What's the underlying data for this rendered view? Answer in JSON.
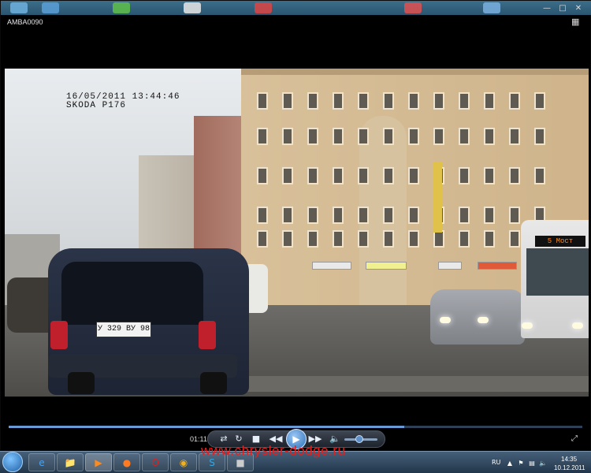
{
  "window": {
    "title": "AMBA0090",
    "minimize_icon": "minimize-icon",
    "maximize_icon": "maximize-icon",
    "close_icon": "close-icon"
  },
  "video": {
    "osd_line1": "16/05/2011  13:44:46",
    "osd_line2": "SKODA P176",
    "plate": "У 329 ВУ 98",
    "bus_destination": "5  Мост"
  },
  "player": {
    "elapsed_time": "01:11",
    "progress_fraction": 0.69,
    "volume_fraction": 0.45,
    "controls": [
      "shuffle-icon",
      "repeat-icon",
      "stop-icon",
      "previous-icon",
      "play-icon",
      "next-icon",
      "volume-icon"
    ],
    "accent_color": "#2a6fb8"
  },
  "taskbar": {
    "watermark": "www.chrysler-dodge.ru",
    "language": "RU",
    "clock_time": "14:35",
    "clock_date": "10.12.2011",
    "pinned": [
      "start-orb-icon",
      "internet-explorer-icon",
      "file-explorer-icon",
      "media-player-icon",
      "firefox-icon",
      "opera-icon",
      "chrome-icon",
      "skype-icon",
      "app-icon"
    ]
  }
}
